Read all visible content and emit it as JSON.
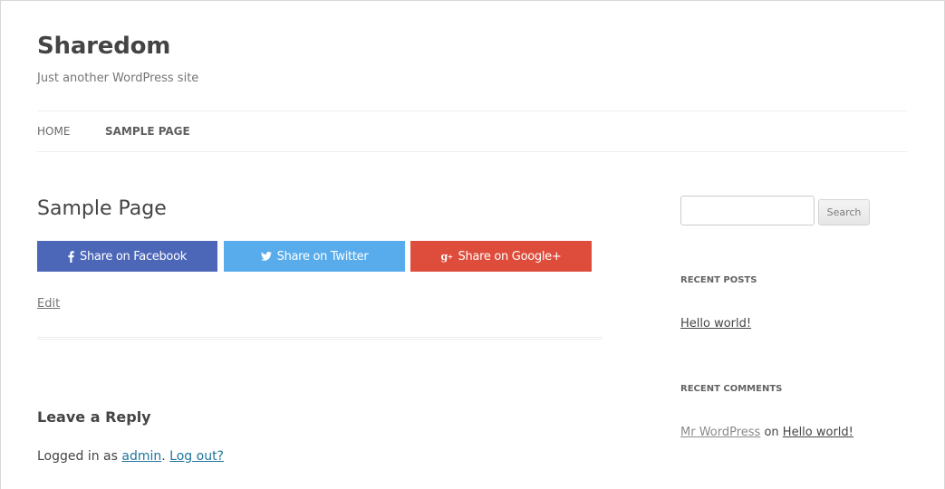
{
  "site": {
    "title": "Sharedom",
    "description": "Just another WordPress site"
  },
  "nav": {
    "items": [
      {
        "label": "HOME",
        "current": false
      },
      {
        "label": "SAMPLE PAGE",
        "current": true
      }
    ]
  },
  "page": {
    "title": "Sample Page",
    "edit_label": "Edit"
  },
  "share": {
    "facebook": {
      "label": "Share on Facebook",
      "icon": "facebook-icon",
      "color": "#4c66b8"
    },
    "twitter": {
      "label": "Share on Twitter",
      "icon": "twitter-icon",
      "color": "#58acec"
    },
    "google": {
      "label": "Share on Google+",
      "icon": "google-plus-icon",
      "color": "#de4c3b"
    }
  },
  "reply": {
    "title": "Leave a Reply",
    "logged_in_prefix": "Logged in as ",
    "user": "admin",
    "separator": ". ",
    "logout_label": "Log out?"
  },
  "sidebar": {
    "search": {
      "value": "",
      "button_label": "Search"
    },
    "recent_posts": {
      "title": "RECENT POSTS",
      "items": [
        "Hello world!"
      ]
    },
    "recent_comments": {
      "title": "RECENT COMMENTS",
      "author": "Mr WordPress",
      "connector": " on ",
      "post": "Hello world!"
    }
  }
}
